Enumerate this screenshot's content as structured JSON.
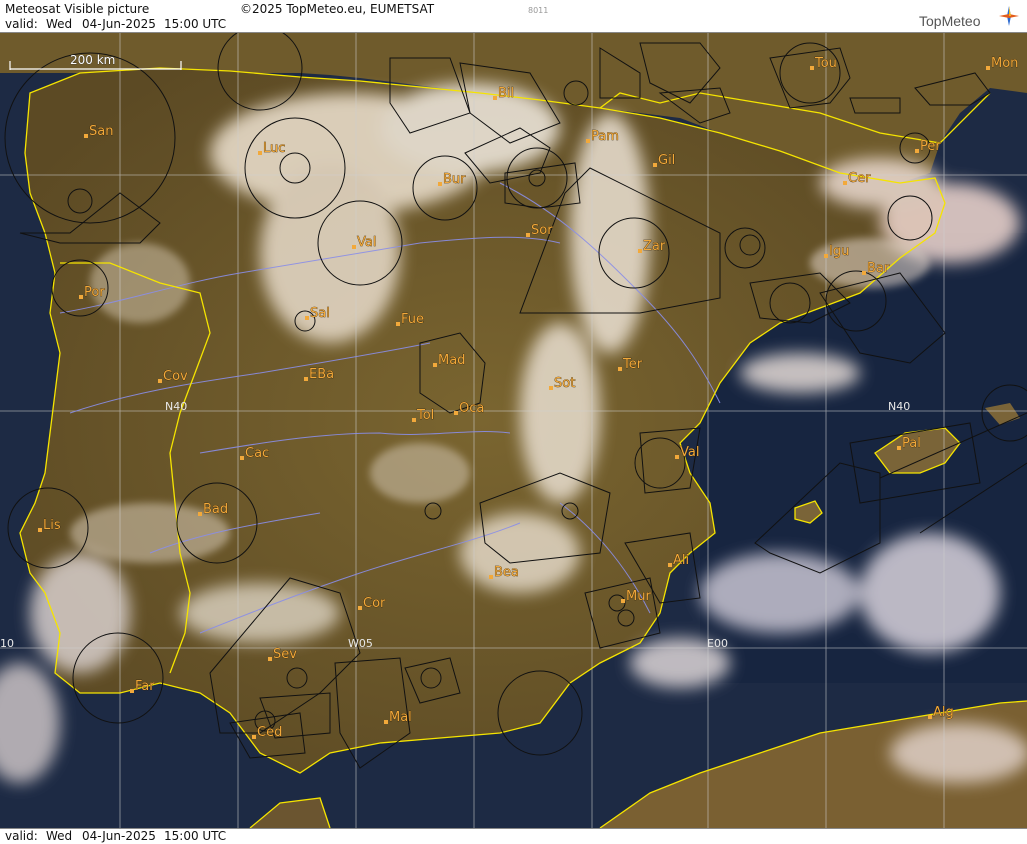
{
  "header": {
    "title": "Meteosat Visible picture",
    "copyright": "©2025 TopMeteo.eu, EUMETSAT",
    "valid_label": "valid:",
    "valid_day": "Wed",
    "valid_date": "04-Jun-2025",
    "valid_time": "15:00 UTC",
    "image_code": "8011",
    "logo_text": "TopMeteo"
  },
  "footer": {
    "valid_label": "valid:",
    "valid_day": "Wed",
    "valid_date": "04-Jun-2025",
    "valid_time": "15:00 UTC"
  },
  "map": {
    "scale_label": "200 km",
    "grid_labels": {
      "n40_west": "N40",
      "n40_east": "N40",
      "w05": "W05",
      "e00": "E00",
      "w10": "10"
    },
    "cities": [
      "Bil",
      "Tou",
      "Mon",
      "San",
      "Luc",
      "Pam",
      "Gil",
      "Per",
      "Bur",
      "Cer",
      "Sor",
      "Val",
      "Zar",
      "Igu",
      "Bar",
      "Por",
      "Sal",
      "Fue",
      "Mad",
      "EBa",
      "Ter",
      "Cov",
      "Sot",
      "Tol",
      "Oca",
      "Cac",
      "Val",
      "Pal",
      "Bad",
      "Lis",
      "Ali",
      "Bea",
      "Mur",
      "Cor",
      "Sev",
      "Far",
      "Mal",
      "Ced",
      "Alg"
    ],
    "colors": {
      "coastline": "#f5e400",
      "airspace": "#111111",
      "rivers": "#8a8ee8",
      "city_label": "#f2a93b",
      "sea": "#1c2a45",
      "land": "#6e5a2e",
      "cloud": "#f0e6dc"
    }
  }
}
